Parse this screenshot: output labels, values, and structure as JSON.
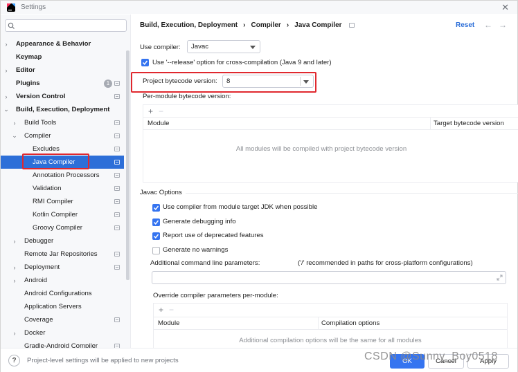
{
  "window": {
    "title": "Settings",
    "close_glyph": "✕"
  },
  "sidebar": {
    "search_placeholder": "Q",
    "items": [
      {
        "label": "Appearance & Behavior",
        "arrow": "›",
        "level": 0,
        "bold": true
      },
      {
        "label": "Keymap",
        "arrow": "",
        "level": 0,
        "bold": true
      },
      {
        "label": "Editor",
        "arrow": "›",
        "level": 0,
        "bold": true
      },
      {
        "label": "Plugins",
        "arrow": "",
        "level": 0,
        "bold": true,
        "badge": "1",
        "proj": true
      },
      {
        "label": "Version Control",
        "arrow": "›",
        "level": 0,
        "bold": true,
        "proj": true
      },
      {
        "label": "Build, Execution, Deployment",
        "arrow": "⌄",
        "level": 0,
        "bold": true
      },
      {
        "label": "Build Tools",
        "arrow": "›",
        "level": 1,
        "proj": true
      },
      {
        "label": "Compiler",
        "arrow": "⌄",
        "level": 1,
        "proj": true
      },
      {
        "label": "Excludes",
        "arrow": "",
        "level": 2,
        "proj": true
      },
      {
        "label": "Java Compiler",
        "arrow": "",
        "level": 2,
        "proj": true,
        "selected": true
      },
      {
        "label": "Annotation Processors",
        "arrow": "",
        "level": 2,
        "proj": true
      },
      {
        "label": "Validation",
        "arrow": "",
        "level": 2,
        "proj": true
      },
      {
        "label": "RMI Compiler",
        "arrow": "",
        "level": 2,
        "proj": true
      },
      {
        "label": "Kotlin Compiler",
        "arrow": "",
        "level": 2,
        "proj": true
      },
      {
        "label": "Groovy Compiler",
        "arrow": "",
        "level": 2,
        "proj": true
      },
      {
        "label": "Debugger",
        "arrow": "›",
        "level": 1
      },
      {
        "label": "Remote Jar Repositories",
        "arrow": "",
        "level": 1,
        "proj": true
      },
      {
        "label": "Deployment",
        "arrow": "›",
        "level": 1,
        "proj": true
      },
      {
        "label": "Android",
        "arrow": "›",
        "level": 1
      },
      {
        "label": "Android Configurations",
        "arrow": "",
        "level": 1
      },
      {
        "label": "Application Servers",
        "arrow": "",
        "level": 1
      },
      {
        "label": "Coverage",
        "arrow": "",
        "level": 1,
        "proj": true
      },
      {
        "label": "Docker",
        "arrow": "›",
        "level": 1
      },
      {
        "label": "Gradle-Android Compiler",
        "arrow": "",
        "level": 1,
        "proj": true
      }
    ]
  },
  "breadcrumb": {
    "parts": [
      "Build, Execution, Deployment",
      "Compiler",
      "Java Compiler"
    ],
    "separator": "›"
  },
  "header": {
    "reset_label": "Reset",
    "back_glyph": "←",
    "forward_glyph": "→"
  },
  "compiler": {
    "use_compiler_label": "Use compiler:",
    "use_compiler_value": "Javac",
    "release_option_label": "Use '--release' option for cross-compilation (Java 9 and later)",
    "release_option_checked": true,
    "bytecode_label": "Project bytecode version:",
    "bytecode_value": "8",
    "per_module_label": "Per-module bytecode version:",
    "module_table": {
      "add_glyph": "+",
      "remove_glyph": "−",
      "columns": [
        "Module",
        "Target bytecode version"
      ],
      "empty_text": "All modules will be compiled with project bytecode version"
    }
  },
  "javac": {
    "section_title": "Javac Options",
    "options": [
      {
        "label": "Use compiler from module target JDK when possible",
        "checked": true
      },
      {
        "label": "Generate debugging info",
        "checked": true
      },
      {
        "label": "Report use of deprecated features",
        "checked": true
      },
      {
        "label": "Generate no warnings",
        "checked": false
      }
    ],
    "additional_params_label": "Additional command line parameters:",
    "additional_params_hint": "('/' recommended in paths for cross-platform configurations)",
    "override_label": "Override compiler parameters per-module:",
    "override_table": {
      "add_glyph": "+",
      "remove_glyph": "−",
      "columns": [
        "Module",
        "Compilation options"
      ],
      "empty_text": "Additional compilation options will be the same for all modules"
    }
  },
  "footer": {
    "help_glyph": "?",
    "message": "Project-level settings will be applied to new projects",
    "ok_label": "OK",
    "cancel_label": "Cancel",
    "apply_label": "Apply"
  },
  "watermark": "CSDN @Sunny_Boy0518",
  "colors": {
    "accent": "#3574f0",
    "selection": "#2d6fd8",
    "highlight_box": "#e0282e"
  }
}
